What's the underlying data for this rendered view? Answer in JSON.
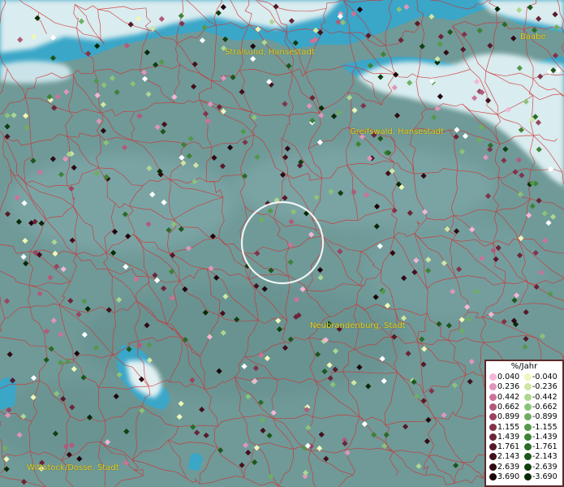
{
  "cities": [
    {
      "name": "Stralsund, Hansestadt"
    },
    {
      "name": "Baabe"
    },
    {
      "name": "Greifswald, Hansestadt"
    },
    {
      "name": "Neubrandenburg, Stadt"
    },
    {
      "name": "Wittstock/Dosse, Stadt"
    }
  ],
  "legend": {
    "title": "%/Jahr",
    "positive": [
      {
        "label": "0.040",
        "color": "#f4b6d6"
      },
      {
        "label": "0.236",
        "color": "#e095bb"
      },
      {
        "label": "0.442",
        "color": "#cc7398"
      },
      {
        "label": "0.662",
        "color": "#b25a7a"
      },
      {
        "label": "0.899",
        "color": "#9a4460"
      },
      {
        "label": "1.155",
        "color": "#82334b"
      },
      {
        "label": "1.439",
        "color": "#6b2538"
      },
      {
        "label": "1.761",
        "color": "#561a29"
      },
      {
        "label": "2.143",
        "color": "#43111d"
      },
      {
        "label": "2.639",
        "color": "#300a13"
      },
      {
        "label": "3.690",
        "color": "#1e050b"
      }
    ],
    "negative": [
      {
        "label": "-0.040",
        "color": "#f0f7b8"
      },
      {
        "label": "-0.236",
        "color": "#cfe6a4"
      },
      {
        "label": "-0.442",
        "color": "#add690"
      },
      {
        "label": "-0.662",
        "color": "#8cc278"
      },
      {
        "label": "-0.899",
        "color": "#6fae62"
      },
      {
        "label": "-1.155",
        "color": "#54984c"
      },
      {
        "label": "-1.439",
        "color": "#3f8238"
      },
      {
        "label": "-1.761",
        "color": "#2c6b28"
      },
      {
        "label": "-2.143",
        "color": "#1d561b"
      },
      {
        "label": "-2.639",
        "color": "#113f10"
      },
      {
        "label": "-3.690",
        "color": "#082a07"
      }
    ]
  },
  "colors": {
    "land": "#6f9a98",
    "water": "#3aa6c8",
    "ice": "#d9ecef",
    "boundaries": "#d0302f",
    "city_label": "#f2d21a",
    "selection_circle": "#ffffff"
  }
}
